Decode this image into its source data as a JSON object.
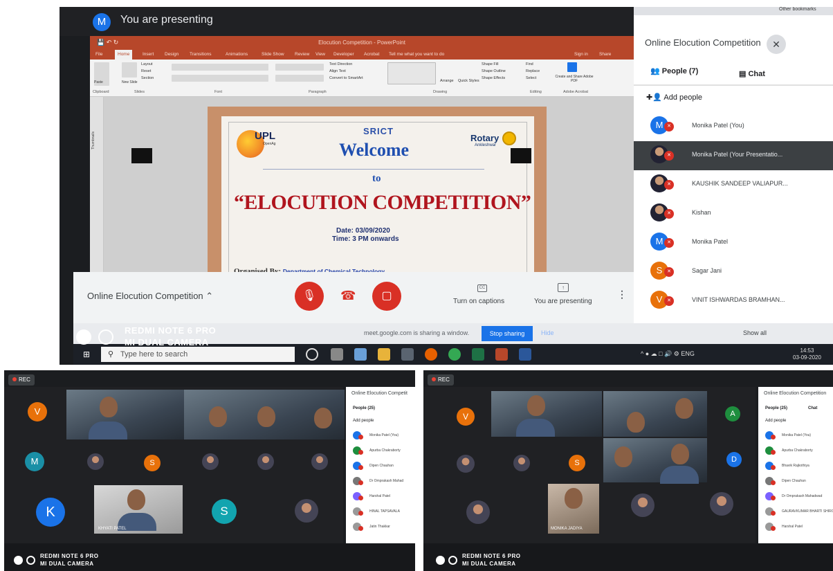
{
  "top_photo": {
    "banner": {
      "avatar_letter": "M",
      "text": "You are presenting"
    },
    "powerpoint": {
      "window_title": "Elocution Competition - PowerPoint",
      "tabs": [
        "File",
        "Home",
        "Insert",
        "Design",
        "Transitions",
        "Animations",
        "Slide Show",
        "Review",
        "View",
        "Developer",
        "Acrobat"
      ],
      "ribbon_groups": [
        "Clipboard",
        "Slides",
        "Font",
        "Paragraph",
        "Drawing",
        "Editing",
        "Adobe Acrobat"
      ],
      "ribbon_items": [
        "Paste",
        "New Slide",
        "Layout",
        "Reset",
        "Section",
        "Text Direction",
        "Align Text",
        "Convert to SmartArt",
        "Arrange",
        "Quick Styles",
        "Shape Fill",
        "Shape Outline",
        "Shape Effects",
        "Find",
        "Replace",
        "Select",
        "Create and Share Adobe PDF"
      ],
      "tell_me": "Tell me what you want to do",
      "sign_in": "Sign in",
      "share": "Share",
      "thumbnails_label": "Thumbnails"
    },
    "slide": {
      "logo_left": "UPL",
      "logo_left_sub": "OpenAg",
      "logo_center": "SRICT",
      "logo_right": "Rotary",
      "logo_right_sub": "Ankleshwar",
      "welcome": "Welcome",
      "to": "to",
      "event": "“ELOCUTION COMPETITION”",
      "date": "Date: 03/09/2020",
      "time": "Time: 3 PM onwards",
      "organised_by": "Organised By:",
      "department": "Department of Chemical Technology"
    },
    "meet_controls": {
      "meeting_name": "Online Elocution Competition",
      "captions_label": "Turn on captions",
      "captions_icon": "CC",
      "presenting_label": "You are presenting"
    },
    "side_panel": {
      "title": "Online Elocution Competition",
      "people_tab": "People (7)",
      "chat_tab": "Chat",
      "add_people": "Add people",
      "participants": [
        {
          "name": "Monika Patel (You)",
          "letter": "M",
          "color": "#1a73e8"
        },
        {
          "name": "Monika Patel (Your Presentatio...",
          "letter": "",
          "color": "#3c4043"
        },
        {
          "name": "KAUSHIK SANDEEP VALIAPUR...",
          "letter": "",
          "color": "#555"
        },
        {
          "name": "Kishan",
          "letter": "",
          "color": "#555"
        },
        {
          "name": "Monika Patel",
          "letter": "M",
          "color": "#1a73e8"
        },
        {
          "name": "Sagar Jani",
          "letter": "S",
          "color": "#e8710a"
        },
        {
          "name": "VINIT ISHWARDAS BRAMHAN...",
          "letter": "V",
          "color": "#e8710a"
        }
      ]
    },
    "share_bar": {
      "message": "meet.google.com is sharing a window.",
      "stop": "Stop sharing",
      "hide": "Hide",
      "show_all": "Show all"
    },
    "watermark": {
      "line1": "REDMI NOTE 6 PRO",
      "line2": "MI DUAL CAMERA"
    },
    "taskbar": {
      "search_placeholder": "Type here to search",
      "tray": "ENG",
      "time": "14:53",
      "date": "03-09-2020"
    },
    "browser_bookmarks": "Other bookmarks"
  },
  "bottom_left_photo": {
    "rec": "REC",
    "panel_title": "Online Elocution Competit",
    "people_tab": "People (25)",
    "add_people": "Add people",
    "participants": [
      "Monika Patel (You)",
      "Apurba Chakraborty",
      "Dipen Chauhan",
      "Dr Omprakash Mahad",
      "Harshal Patel",
      "HINAL TAPSAVALA",
      "Jatin Thakkar"
    ],
    "tile_name": "KHYATI PATEL",
    "avatar_letters": [
      "V",
      "M",
      "S",
      "K",
      "S"
    ],
    "watermark": {
      "line1": "REDMI NOTE 6 PRO",
      "line2": "MI DUAL CAMERA"
    }
  },
  "bottom_right_photo": {
    "rec": "REC",
    "panel_title": "Online Elocution Competition",
    "people_tab": "People (25)",
    "chat_tab": "Chat",
    "add_people": "Add people",
    "participants": [
      "Monika Patel (You)",
      "Apurba Chakraborty",
      "Bhavik Rajkothiya",
      "Dipen Chauhan",
      "Dr Omprakash Mahadwad",
      "GAURAVKUMAR BHARTI SHIRODKAR",
      "Harshal Patel"
    ],
    "tile_name": "MONIKA JADIYA",
    "avatar_letters": [
      "V",
      "S",
      "A",
      "D"
    ],
    "watermark": {
      "line1": "REDMI NOTE 6 PRO",
      "line2": "MI DUAL CAMERA"
    }
  }
}
